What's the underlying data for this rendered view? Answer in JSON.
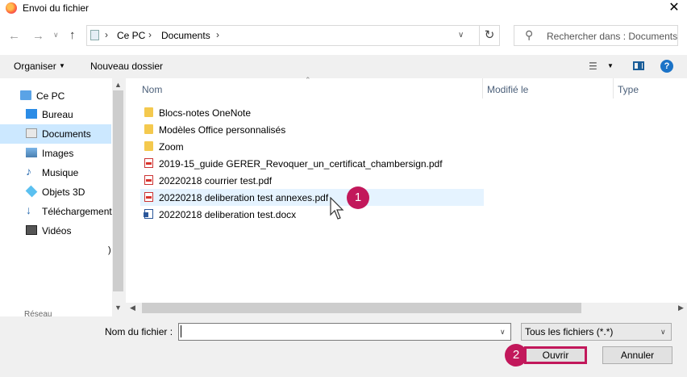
{
  "window": {
    "title": "Envoi du fichier",
    "close_glyph": "✕"
  },
  "address": {
    "crumbs": [
      "Ce PC",
      "Documents"
    ],
    "search_placeholder": "Rechercher dans : Documents"
  },
  "toolbar": {
    "organiser": "Organiser",
    "new_folder": "Nouveau dossier",
    "help": "?"
  },
  "nav": {
    "items": [
      {
        "label": "Ce PC",
        "icon": "computer-icon"
      },
      {
        "label": "Bureau",
        "icon": "desktop-icon"
      },
      {
        "label": "Documents",
        "icon": "documents-icon",
        "selected": true
      },
      {
        "label": "Images",
        "icon": "images-icon"
      },
      {
        "label": "Musique",
        "icon": "music-icon"
      },
      {
        "label": "Objets 3D",
        "icon": "objects-3d-icon"
      },
      {
        "label": "Téléchargements",
        "icon": "download-icon"
      },
      {
        "label": "Vidéos",
        "icon": "video-icon"
      }
    ],
    "truncated_paren": ")",
    "partial_item": "Réseau"
  },
  "columns": {
    "name": "Nom",
    "modified": "Modifié le",
    "type": "Type"
  },
  "files": [
    {
      "name": "Blocs-notes OneNote",
      "kind": "folder"
    },
    {
      "name": "Modèles Office personnalisés",
      "kind": "folder"
    },
    {
      "name": "Zoom",
      "kind": "folder"
    },
    {
      "name": "2019-15_guide GERER_Revoquer_un_certificat_chambersign.pdf",
      "kind": "pdf"
    },
    {
      "name": "20220218 courrier test.pdf",
      "kind": "pdf"
    },
    {
      "name": "20220218 deliberation test annexes.pdf",
      "kind": "pdf",
      "hovered": true
    },
    {
      "name": "20220218 deliberation test.docx",
      "kind": "docx"
    }
  ],
  "callouts": [
    "1",
    "2"
  ],
  "bottom": {
    "filename_label": "Nom du fichier :",
    "filename_value": "",
    "filetype": "Tous les fichiers (*.*)",
    "open": "Ouvrir",
    "cancel": "Annuler"
  },
  "colors": {
    "accent": "#c2185b",
    "selection": "#cce8ff",
    "hover": "#e5f3ff"
  }
}
